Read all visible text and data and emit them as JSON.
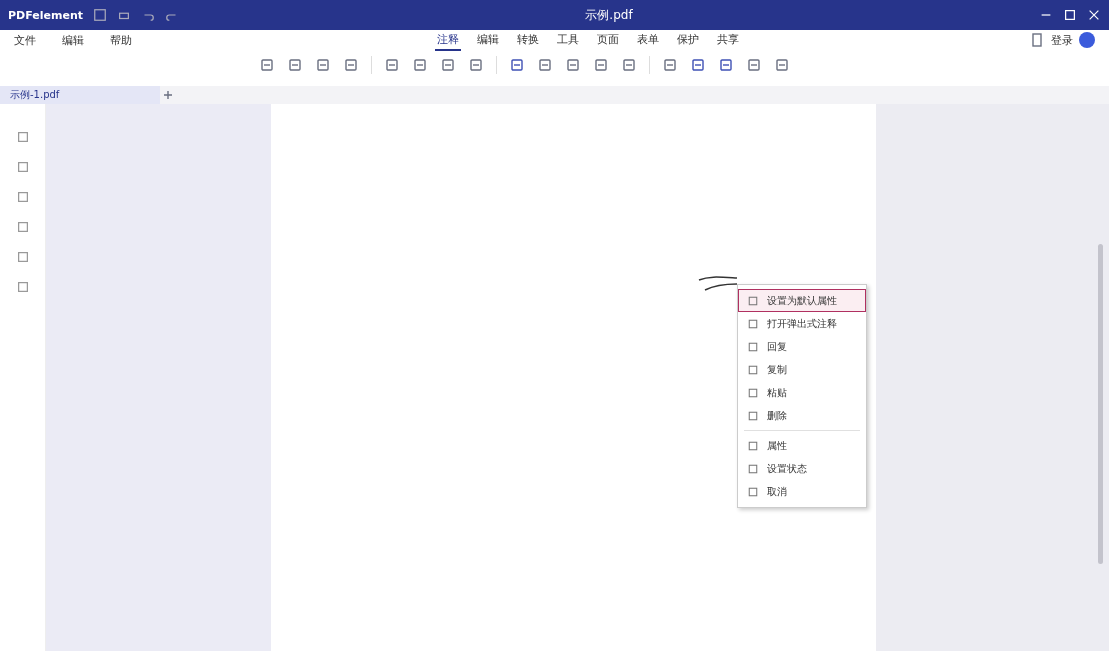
{
  "window": {
    "app_name": "PDFelement",
    "title": "示例.pdf"
  },
  "menu": [
    "文件",
    "编辑",
    "帮助"
  ],
  "ribbon_tabs": [
    {
      "label": "注释",
      "selected": true
    },
    {
      "label": "编辑",
      "selected": false
    },
    {
      "label": "转换",
      "selected": false
    },
    {
      "label": "工具",
      "selected": false
    },
    {
      "label": "页面",
      "selected": false
    },
    {
      "label": "表单",
      "selected": false
    },
    {
      "label": "保护",
      "selected": false
    },
    {
      "label": "共享",
      "selected": false
    }
  ],
  "account": {
    "label": "登录"
  },
  "document_tab": {
    "label": "示例-1.pdf"
  },
  "context_menu": [
    {
      "label": "设置为默认属性",
      "selected": true,
      "separator_before": false
    },
    {
      "label": "打开弹出式注释",
      "selected": false,
      "separator_before": false
    },
    {
      "label": "回复",
      "selected": false,
      "separator_before": false
    },
    {
      "label": "复制",
      "selected": false,
      "separator_before": false
    },
    {
      "label": "粘贴",
      "selected": false,
      "separator_before": false
    },
    {
      "label": "删除",
      "selected": false,
      "separator_before": false
    },
    {
      "label": "属性",
      "selected": false,
      "separator_before": true
    },
    {
      "label": "设置状态",
      "selected": false,
      "separator_before": false
    },
    {
      "label": "取消",
      "selected": false,
      "separator_before": false
    }
  ]
}
